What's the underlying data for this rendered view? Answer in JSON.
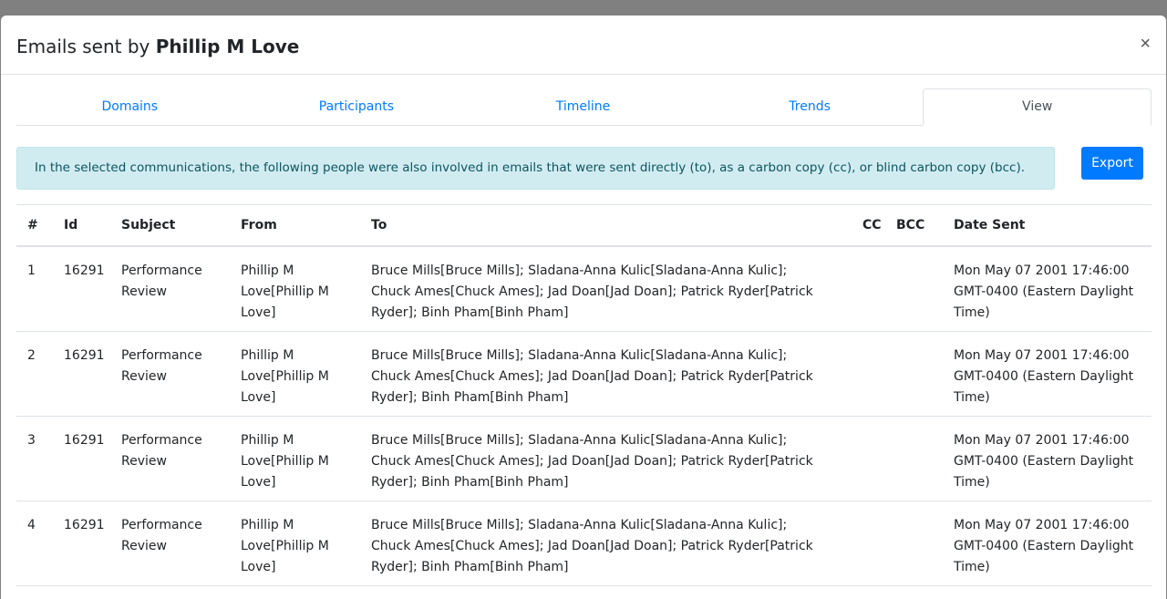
{
  "modal": {
    "title_prefix": "Emails sent by",
    "title_name": "Phillip M Love",
    "close": "×"
  },
  "tabs": [
    {
      "label": "Domains"
    },
    {
      "label": "Participants"
    },
    {
      "label": "Timeline"
    },
    {
      "label": "Trends"
    },
    {
      "label": "View"
    }
  ],
  "alert": {
    "text": "In the selected communications, the following people were also involved in emails that were sent directly (to), as a carbon copy (cc), or blind carbon copy (bcc)."
  },
  "export": {
    "label": "Export"
  },
  "table": {
    "headers": {
      "num": "#",
      "id": "Id",
      "subject": "Subject",
      "from": "From",
      "to": "To",
      "cc": "CC",
      "bcc": "BCC",
      "date": "Date Sent"
    },
    "rows": [
      {
        "num": "1",
        "id": "16291",
        "subject": "Performance Review",
        "from": "Phillip M Love[Phillip M Love]",
        "to": "Bruce Mills[Bruce Mills]; Sladana-Anna Kulic[Sladana-Anna Kulic]; Chuck Ames[Chuck Ames]; Jad Doan[Jad Doan]; Patrick Ryder[Patrick Ryder]; Binh Pham[Binh Pham]",
        "cc": "",
        "bcc": "",
        "date": "Mon May 07 2001 17:46:00 GMT-0400 (Eastern Daylight Time)"
      },
      {
        "num": "2",
        "id": "16291",
        "subject": "Performance Review",
        "from": "Phillip M Love[Phillip M Love]",
        "to": "Bruce Mills[Bruce Mills]; Sladana-Anna Kulic[Sladana-Anna Kulic]; Chuck Ames[Chuck Ames]; Jad Doan[Jad Doan]; Patrick Ryder[Patrick Ryder]; Binh Pham[Binh Pham]",
        "cc": "",
        "bcc": "",
        "date": "Mon May 07 2001 17:46:00 GMT-0400 (Eastern Daylight Time)"
      },
      {
        "num": "3",
        "id": "16291",
        "subject": "Performance Review",
        "from": "Phillip M Love[Phillip M Love]",
        "to": "Bruce Mills[Bruce Mills]; Sladana-Anna Kulic[Sladana-Anna Kulic]; Chuck Ames[Chuck Ames]; Jad Doan[Jad Doan]; Patrick Ryder[Patrick Ryder]; Binh Pham[Binh Pham]",
        "cc": "",
        "bcc": "",
        "date": "Mon May 07 2001 17:46:00 GMT-0400 (Eastern Daylight Time)"
      },
      {
        "num": "4",
        "id": "16291",
        "subject": "Performance Review",
        "from": "Phillip M Love[Phillip M Love]",
        "to": "Bruce Mills[Bruce Mills]; Sladana-Anna Kulic[Sladana-Anna Kulic]; Chuck Ames[Chuck Ames]; Jad Doan[Jad Doan]; Patrick Ryder[Patrick Ryder]; Binh Pham[Binh Pham]",
        "cc": "",
        "bcc": "",
        "date": "Mon May 07 2001 17:46:00 GMT-0400 (Eastern Daylight Time)"
      }
    ]
  }
}
